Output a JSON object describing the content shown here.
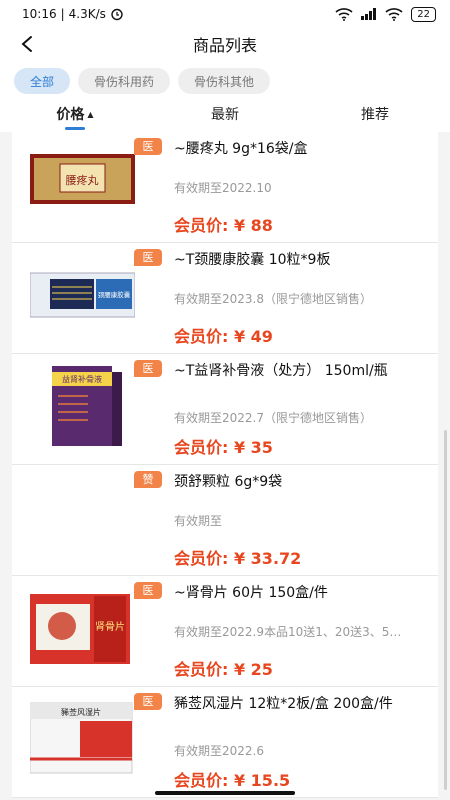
{
  "status_bar": {
    "time": "10:16",
    "speed": "4.3K/s",
    "battery": "22"
  },
  "nav": {
    "title": "商品列表"
  },
  "categories": [
    {
      "label": "全部",
      "active": true
    },
    {
      "label": "骨伤科用药",
      "active": false
    },
    {
      "label": "骨伤科其他",
      "active": false
    }
  ],
  "sort_tabs": [
    {
      "label": "价格",
      "arrow": "▲"
    },
    {
      "label": "最新"
    },
    {
      "label": "推荐"
    }
  ],
  "products": [
    {
      "tag": "医",
      "name": "~腰疼丸 9g*16袋/盒",
      "expiry": "有效期至2022.10",
      "price": "会员价: ¥ 88",
      "box_label": "腰疼丸"
    },
    {
      "tag": "医",
      "name": "~T颈腰康胶囊 10粒*9板",
      "expiry": "有效期至2023.8（限宁德地区销售）",
      "price": "会员价: ¥ 49",
      "box_label": "颈腰康胶囊"
    },
    {
      "tag": "医",
      "name": "~T益肾补骨液（处方） 150ml/瓶",
      "expiry": "有效期至2022.7（限宁德地区销售）",
      "price": "会员价: ¥ 35",
      "box_label": "益肾补骨液"
    },
    {
      "tag": "赞",
      "name": "颈舒颗粒 6g*9袋",
      "expiry": "有效期至",
      "price": "会员价: ¥ 33.72",
      "box_label": ""
    },
    {
      "tag": "医",
      "name": "~肾骨片 60片 150盒/件",
      "expiry": "有效期至2022.9本品10送1、20送3、5…",
      "price": "会员价: ¥ 25",
      "box_label": "肾骨片"
    },
    {
      "tag": "医",
      "name": "豨莶风湿片 12粒*2板/盒 200盒/件",
      "expiry": "有效期至2022.6",
      "price": "会员价: ¥ 15.5",
      "box_label": "豨莶风湿片"
    }
  ]
}
